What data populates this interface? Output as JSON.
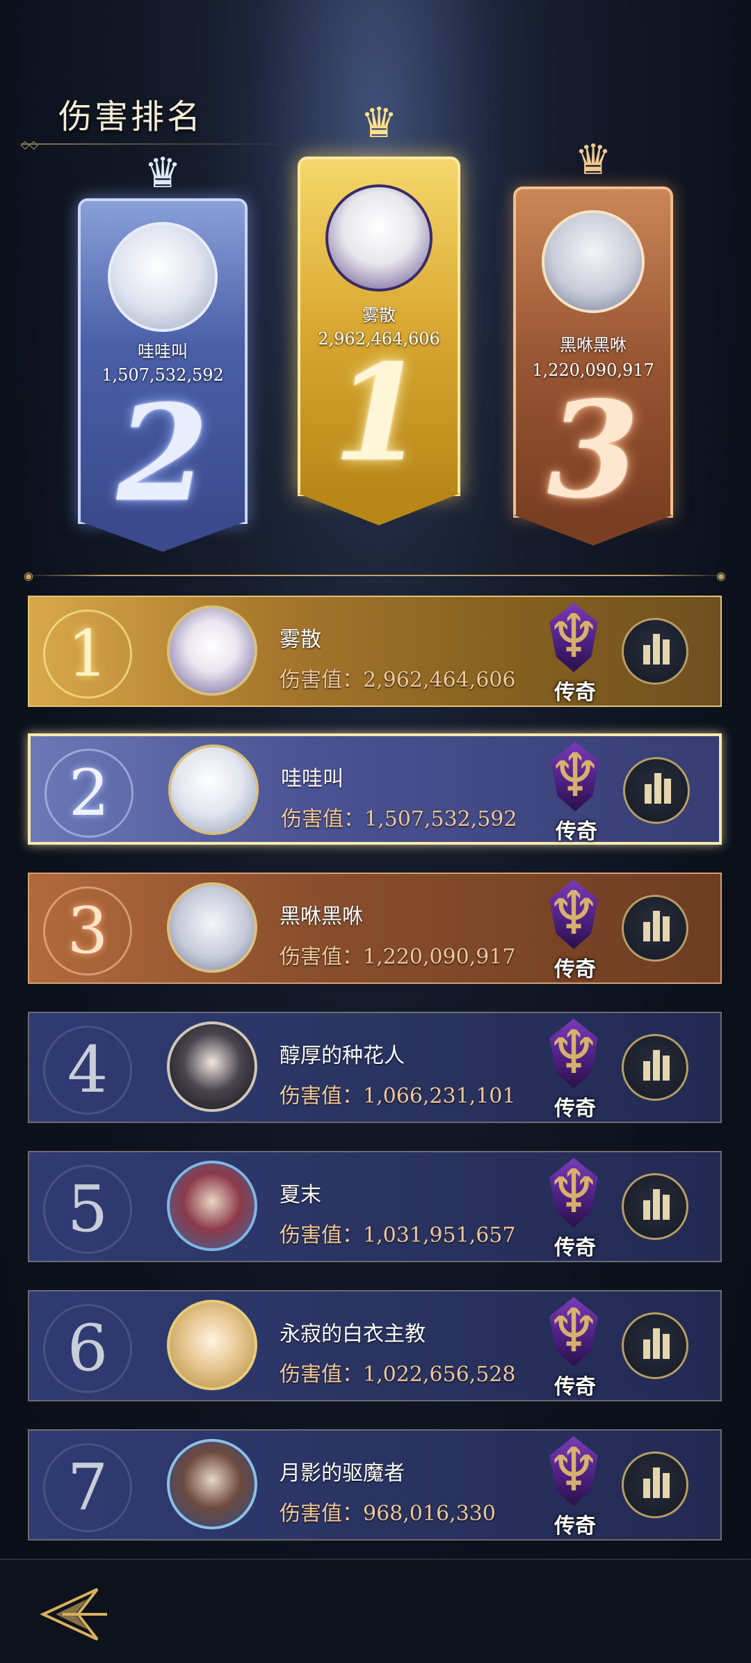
{
  "header": {
    "title": "伤害排名"
  },
  "podium": [
    {
      "rank_display": "2",
      "name": "哇哇叫",
      "score": "1,507,532,592"
    },
    {
      "rank_display": "1",
      "name": "雾散",
      "score": "2,962,464,606"
    },
    {
      "rank_display": "3",
      "name": "黑咻黑咻",
      "score": "1,220,090,917"
    }
  ],
  "rows": [
    {
      "rank": "1",
      "name": "雾散",
      "damage": "伤害值：2,962,464,606",
      "badge": "传奇",
      "avatar": "sunglasses-girl-avatar"
    },
    {
      "rank": "2",
      "name": "哇哇叫",
      "damage": "伤害值：1,507,532,592",
      "badge": "传奇",
      "avatar": "white-cat-avatar"
    },
    {
      "rank": "3",
      "name": "黑咻黑咻",
      "damage": "伤害值：1,220,090,917",
      "badge": "传奇",
      "avatar": "elf-girl-avatar"
    },
    {
      "rank": "4",
      "name": "醇厚的种花人",
      "damage": "伤害值：1,066,231,101",
      "badge": "传奇",
      "avatar": "dark-hair-girl-avatar"
    },
    {
      "rank": "5",
      "name": "夏末",
      "damage": "伤害值：1,031,951,657",
      "badge": "传奇",
      "avatar": "armored-warrior-avatar"
    },
    {
      "rank": "6",
      "name": "永寂的白衣主教",
      "damage": "伤害值：1,022,656,528",
      "badge": "传奇",
      "avatar": "blonde-girl-avatar"
    },
    {
      "rank": "7",
      "name": "月影的驱魔者",
      "damage": "伤害值：968,016,330",
      "badge": "传奇",
      "avatar": "crowned-queen-avatar"
    }
  ],
  "icons": {
    "stats": "bar-chart-icon",
    "legend": "legend-emblem-icon",
    "back": "back-arrow-icon",
    "crown": "crown-icon"
  },
  "colors": {
    "gold": "#d8a94a",
    "silver": "#6c78b6",
    "bronze": "#b26a3d",
    "normal": "#2f3b73",
    "damage_text": "#f1c89c"
  }
}
